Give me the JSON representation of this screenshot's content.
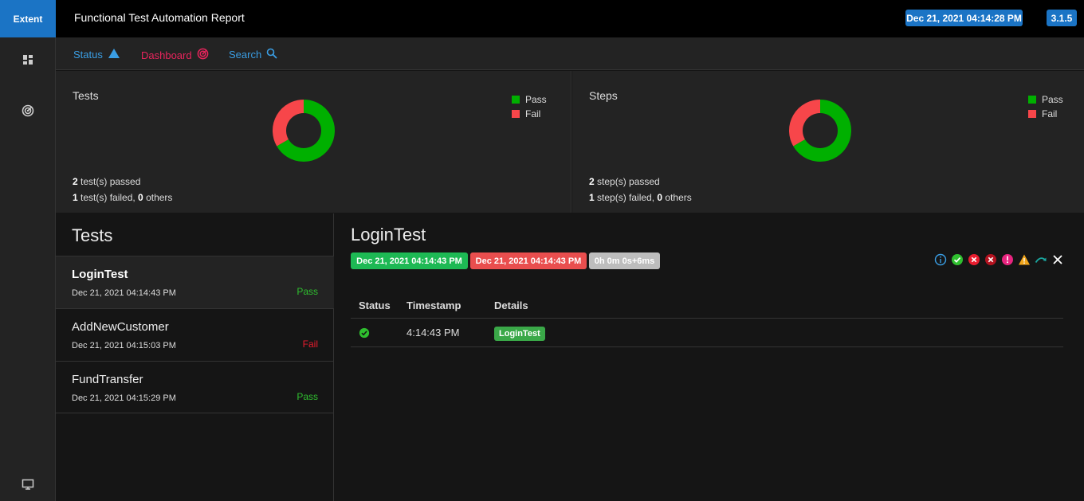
{
  "header": {
    "brand": "Extent",
    "title": "Functional Test Automation Report",
    "date": "Dec 21, 2021 04:14:28 PM",
    "version": "3.1.5"
  },
  "sidebar": {
    "items": [
      {
        "icon": "dashboard-icon"
      },
      {
        "icon": "radar-icon"
      },
      {
        "icon": "monitor-icon"
      }
    ]
  },
  "subnav": {
    "status_label": "Status",
    "dashboard_label": "Dashboard",
    "search_label": "Search"
  },
  "tests_card": {
    "title": "Tests",
    "legend_pass": "Pass",
    "legend_fail": "Fail",
    "passed_count": "2",
    "passed_text": " test(s) passed",
    "failed_count": "1",
    "failed_text": " test(s) failed, ",
    "others_count": "0",
    "others_text": " others"
  },
  "steps_card": {
    "title": "Steps",
    "legend_pass": "Pass",
    "legend_fail": "Fail",
    "passed_count": "2",
    "passed_text": " step(s) passed",
    "failed_count": "1",
    "failed_text": " step(s) failed, ",
    "others_count": "0",
    "others_text": " others"
  },
  "colors": {
    "pass": "#00b000",
    "fail": "#f7464a",
    "accent": "#1b74c5"
  },
  "chart_data": [
    {
      "type": "pie",
      "categories": [
        "Pass",
        "Fail"
      ],
      "values": [
        2,
        1
      ]
    },
    {
      "type": "pie",
      "categories": [
        "Pass",
        "Fail"
      ],
      "values": [
        2,
        1
      ]
    }
  ],
  "test_list": {
    "heading": "Tests",
    "items": [
      {
        "name": "LoginTest",
        "date": "Dec 21, 2021 04:14:43 PM",
        "status": "Pass"
      },
      {
        "name": "AddNewCustomer",
        "date": "Dec 21, 2021 04:15:03 PM",
        "status": "Fail"
      },
      {
        "name": "FundTransfer",
        "date": "Dec 21, 2021 04:15:29 PM",
        "status": "Pass"
      }
    ]
  },
  "detail": {
    "title": "LoginTest",
    "start_time": "Dec 21, 2021 04:14:43 PM",
    "end_time": "Dec 21, 2021 04:14:43 PM",
    "duration": "0h 0m 0s+6ms",
    "columns": [
      "Status",
      "Timestamp",
      "Details"
    ],
    "rows": [
      {
        "status_icon": "check-circle-icon",
        "timestamp": "4:14:43 PM",
        "details": "LoginTest"
      }
    ]
  }
}
